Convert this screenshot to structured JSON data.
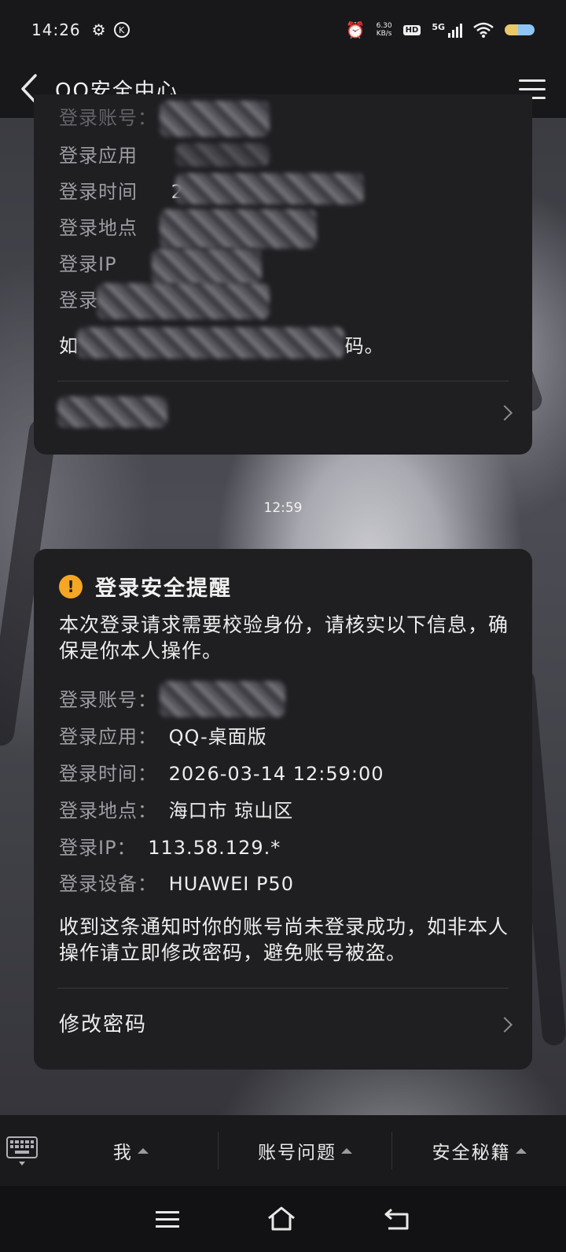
{
  "status_bar": {
    "time": "14:26",
    "net_speed_value": "6.30",
    "net_speed_unit": "KB/s",
    "hd": "HD",
    "network": "5G"
  },
  "header": {
    "title": "QQ安全中心"
  },
  "previous_card": {
    "rows": [
      {
        "label": "登录应用"
      },
      {
        "label": "登录时间",
        "value": "2"
      },
      {
        "label": "登录地点"
      },
      {
        "label": "登录IP"
      },
      {
        "label": "登录"
      }
    ],
    "notice_start": "如",
    "notice_end": "码。"
  },
  "timestamp": "12:59",
  "alert_card": {
    "title": "登录安全提醒",
    "intro": "本次登录请求需要校验身份，请核实以下信息，确保是你本人操作。",
    "fields": [
      {
        "label": "登录账号：",
        "value": ""
      },
      {
        "label": "登录应用：",
        "value": "QQ-桌面版"
      },
      {
        "label": "登录时间：",
        "value": "2026-03-14 12:59:00"
      },
      {
        "label": "登录地点：",
        "value": "海口市 琼山区"
      },
      {
        "label": "登录IP：",
        "value": "113.58.129.*"
      },
      {
        "label": "登录设备：",
        "value": "HUAWEI P50"
      }
    ],
    "warning": "收到这条通知时你的账号尚未登录成功，如非本人操作请立即修改密码，避免账号被盗。",
    "action_label": "修改密码"
  },
  "bottom_menu": {
    "items": [
      {
        "label": "我"
      },
      {
        "label": "账号问题"
      },
      {
        "label": "安全秘籍"
      }
    ]
  },
  "colors": {
    "background": "#16161a",
    "card": "#1f1f22",
    "warning_icon": "#f5a623",
    "label_gray": "#9c9ca2"
  }
}
